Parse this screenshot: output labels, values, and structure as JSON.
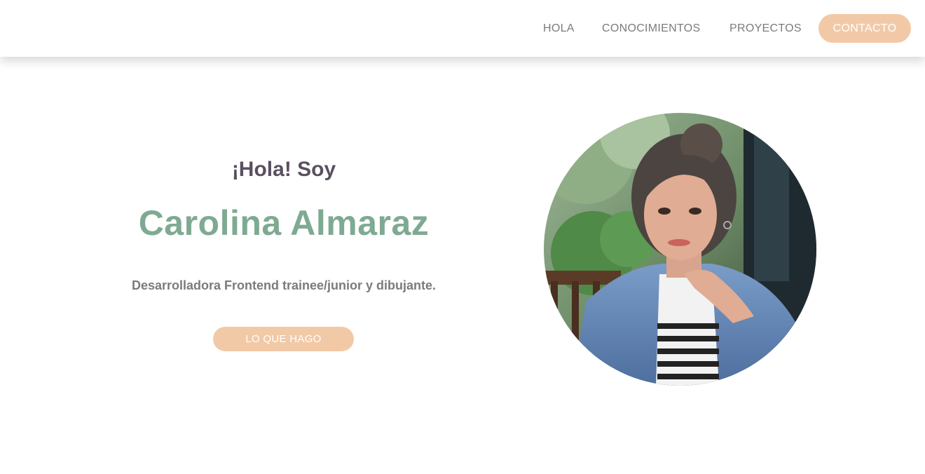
{
  "nav": {
    "items": [
      {
        "label": "HOLA"
      },
      {
        "label": "CONOCIMIENTOS"
      },
      {
        "label": "PROYECTOS"
      }
    ],
    "contact_label": "CONTACTO"
  },
  "hero": {
    "greeting": "¡Hola! Soy",
    "name": "Carolina Almaraz",
    "tagline": "Desarrolladora Frontend trainee/junior y dibujante.",
    "cta_label": "LO QUE HAGO"
  },
  "colors": {
    "accent": "#f2c9a7",
    "name_green": "#7faa92",
    "text_gray": "#7d7a7e",
    "heading_dark": "#5a5060"
  },
  "avatar": {
    "icon": "profile-photo"
  }
}
